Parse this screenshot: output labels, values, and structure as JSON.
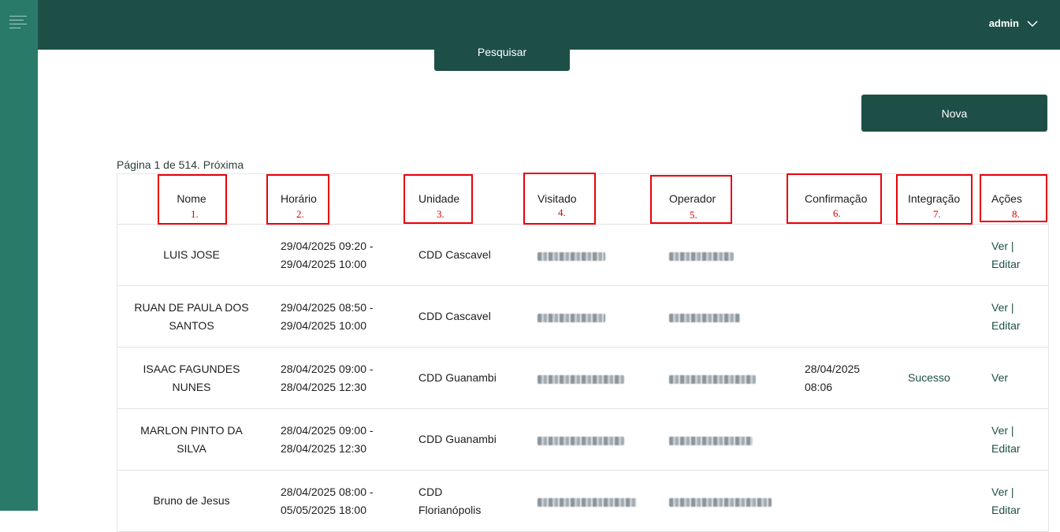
{
  "header": {
    "user": "admin"
  },
  "search": {
    "button": "Pesquisar"
  },
  "new_button": "Nova",
  "pagination": {
    "text": "Página 1 de 514.",
    "next": "Próxima"
  },
  "table": {
    "columns": [
      "Nome",
      "Horário",
      "Unidade",
      "Visitado",
      "Operador",
      "Confirmação",
      "Integração",
      "Ações"
    ],
    "rows": [
      {
        "nome": [
          "LUIS JOSE"
        ],
        "horario": [
          "29/04/2025 09:20 -",
          "29/04/2025 10:00"
        ],
        "unidade": [
          "CDD Cascavel"
        ],
        "confirmacao": [],
        "integracao": "",
        "acoes": [
          "Ver |",
          "Editar"
        ]
      },
      {
        "nome": [
          "RUAN DE PAULA DOS",
          "SANTOS"
        ],
        "horario": [
          "29/04/2025 08:50 -",
          "29/04/2025 10:00"
        ],
        "unidade": [
          "CDD Cascavel"
        ],
        "confirmacao": [],
        "integracao": "",
        "acoes": [
          "Ver |",
          "Editar"
        ]
      },
      {
        "nome": [
          "ISAAC FAGUNDES",
          "NUNES"
        ],
        "horario": [
          "28/04/2025 09:00 -",
          "28/04/2025 12:30"
        ],
        "unidade": [
          "CDD Guanambi"
        ],
        "confirmacao": [
          "28/04/2025",
          "08:06"
        ],
        "integracao": "Sucesso",
        "acoes": [
          "Ver"
        ]
      },
      {
        "nome": [
          "MARLON PINTO DA",
          "SILVA"
        ],
        "horario": [
          "28/04/2025 09:00 -",
          "28/04/2025 12:30"
        ],
        "unidade": [
          "CDD Guanambi"
        ],
        "confirmacao": [],
        "integracao": "",
        "acoes": [
          "Ver |",
          "Editar"
        ]
      },
      {
        "nome": [
          "Bruno de Jesus"
        ],
        "horario": [
          "28/04/2025 08:00 -",
          "05/05/2025 18:00"
        ],
        "unidade": [
          "CDD",
          "Florianópolis"
        ],
        "confirmacao": [],
        "integracao": "",
        "acoes": [
          "Ver |",
          "Editar"
        ]
      }
    ]
  },
  "annotations": [
    "1.",
    "2.",
    "3.",
    "4.",
    "5.",
    "6.",
    "7.",
    "8."
  ],
  "colors": {
    "sidebar": "#2a7a6a",
    "topbar": "#1e4f47",
    "button": "#1e4f47",
    "annotation": "#e8000b"
  }
}
